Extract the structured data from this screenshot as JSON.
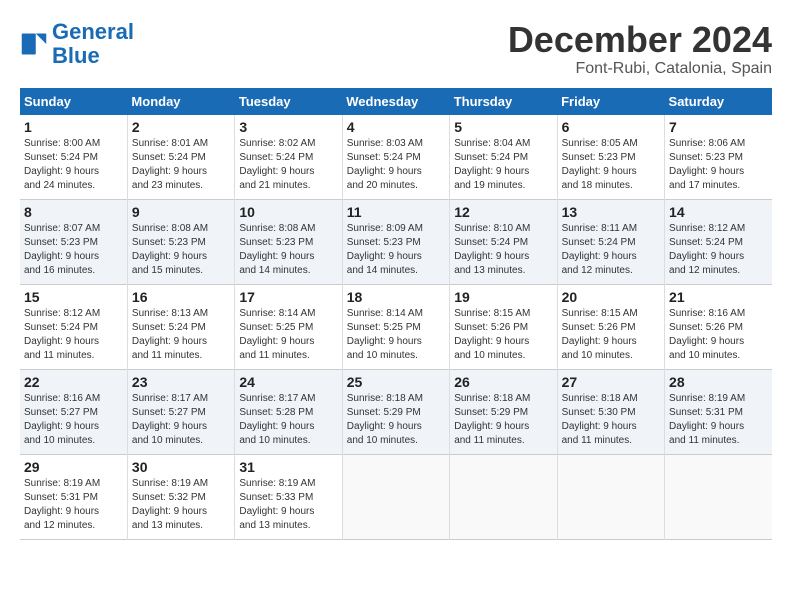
{
  "logo": {
    "line1": "General",
    "line2": "Blue"
  },
  "title": "December 2024",
  "subtitle": "Font-Rubi, Catalonia, Spain",
  "weekdays": [
    "Sunday",
    "Monday",
    "Tuesday",
    "Wednesday",
    "Thursday",
    "Friday",
    "Saturday"
  ],
  "weeks": [
    [
      {
        "day": "1",
        "detail": "Sunrise: 8:00 AM\nSunset: 5:24 PM\nDaylight: 9 hours\nand 24 minutes."
      },
      {
        "day": "2",
        "detail": "Sunrise: 8:01 AM\nSunset: 5:24 PM\nDaylight: 9 hours\nand 23 minutes."
      },
      {
        "day": "3",
        "detail": "Sunrise: 8:02 AM\nSunset: 5:24 PM\nDaylight: 9 hours\nand 21 minutes."
      },
      {
        "day": "4",
        "detail": "Sunrise: 8:03 AM\nSunset: 5:24 PM\nDaylight: 9 hours\nand 20 minutes."
      },
      {
        "day": "5",
        "detail": "Sunrise: 8:04 AM\nSunset: 5:24 PM\nDaylight: 9 hours\nand 19 minutes."
      },
      {
        "day": "6",
        "detail": "Sunrise: 8:05 AM\nSunset: 5:23 PM\nDaylight: 9 hours\nand 18 minutes."
      },
      {
        "day": "7",
        "detail": "Sunrise: 8:06 AM\nSunset: 5:23 PM\nDaylight: 9 hours\nand 17 minutes."
      }
    ],
    [
      {
        "day": "8",
        "detail": "Sunrise: 8:07 AM\nSunset: 5:23 PM\nDaylight: 9 hours\nand 16 minutes."
      },
      {
        "day": "9",
        "detail": "Sunrise: 8:08 AM\nSunset: 5:23 PM\nDaylight: 9 hours\nand 15 minutes."
      },
      {
        "day": "10",
        "detail": "Sunrise: 8:08 AM\nSunset: 5:23 PM\nDaylight: 9 hours\nand 14 minutes."
      },
      {
        "day": "11",
        "detail": "Sunrise: 8:09 AM\nSunset: 5:23 PM\nDaylight: 9 hours\nand 14 minutes."
      },
      {
        "day": "12",
        "detail": "Sunrise: 8:10 AM\nSunset: 5:24 PM\nDaylight: 9 hours\nand 13 minutes."
      },
      {
        "day": "13",
        "detail": "Sunrise: 8:11 AM\nSunset: 5:24 PM\nDaylight: 9 hours\nand 12 minutes."
      },
      {
        "day": "14",
        "detail": "Sunrise: 8:12 AM\nSunset: 5:24 PM\nDaylight: 9 hours\nand 12 minutes."
      }
    ],
    [
      {
        "day": "15",
        "detail": "Sunrise: 8:12 AM\nSunset: 5:24 PM\nDaylight: 9 hours\nand 11 minutes."
      },
      {
        "day": "16",
        "detail": "Sunrise: 8:13 AM\nSunset: 5:24 PM\nDaylight: 9 hours\nand 11 minutes."
      },
      {
        "day": "17",
        "detail": "Sunrise: 8:14 AM\nSunset: 5:25 PM\nDaylight: 9 hours\nand 11 minutes."
      },
      {
        "day": "18",
        "detail": "Sunrise: 8:14 AM\nSunset: 5:25 PM\nDaylight: 9 hours\nand 10 minutes."
      },
      {
        "day": "19",
        "detail": "Sunrise: 8:15 AM\nSunset: 5:26 PM\nDaylight: 9 hours\nand 10 minutes."
      },
      {
        "day": "20",
        "detail": "Sunrise: 8:15 AM\nSunset: 5:26 PM\nDaylight: 9 hours\nand 10 minutes."
      },
      {
        "day": "21",
        "detail": "Sunrise: 8:16 AM\nSunset: 5:26 PM\nDaylight: 9 hours\nand 10 minutes."
      }
    ],
    [
      {
        "day": "22",
        "detail": "Sunrise: 8:16 AM\nSunset: 5:27 PM\nDaylight: 9 hours\nand 10 minutes."
      },
      {
        "day": "23",
        "detail": "Sunrise: 8:17 AM\nSunset: 5:27 PM\nDaylight: 9 hours\nand 10 minutes."
      },
      {
        "day": "24",
        "detail": "Sunrise: 8:17 AM\nSunset: 5:28 PM\nDaylight: 9 hours\nand 10 minutes."
      },
      {
        "day": "25",
        "detail": "Sunrise: 8:18 AM\nSunset: 5:29 PM\nDaylight: 9 hours\nand 10 minutes."
      },
      {
        "day": "26",
        "detail": "Sunrise: 8:18 AM\nSunset: 5:29 PM\nDaylight: 9 hours\nand 11 minutes."
      },
      {
        "day": "27",
        "detail": "Sunrise: 8:18 AM\nSunset: 5:30 PM\nDaylight: 9 hours\nand 11 minutes."
      },
      {
        "day": "28",
        "detail": "Sunrise: 8:19 AM\nSunset: 5:31 PM\nDaylight: 9 hours\nand 11 minutes."
      }
    ],
    [
      {
        "day": "29",
        "detail": "Sunrise: 8:19 AM\nSunset: 5:31 PM\nDaylight: 9 hours\nand 12 minutes."
      },
      {
        "day": "30",
        "detail": "Sunrise: 8:19 AM\nSunset: 5:32 PM\nDaylight: 9 hours\nand 13 minutes."
      },
      {
        "day": "31",
        "detail": "Sunrise: 8:19 AM\nSunset: 5:33 PM\nDaylight: 9 hours\nand 13 minutes."
      },
      null,
      null,
      null,
      null
    ]
  ]
}
